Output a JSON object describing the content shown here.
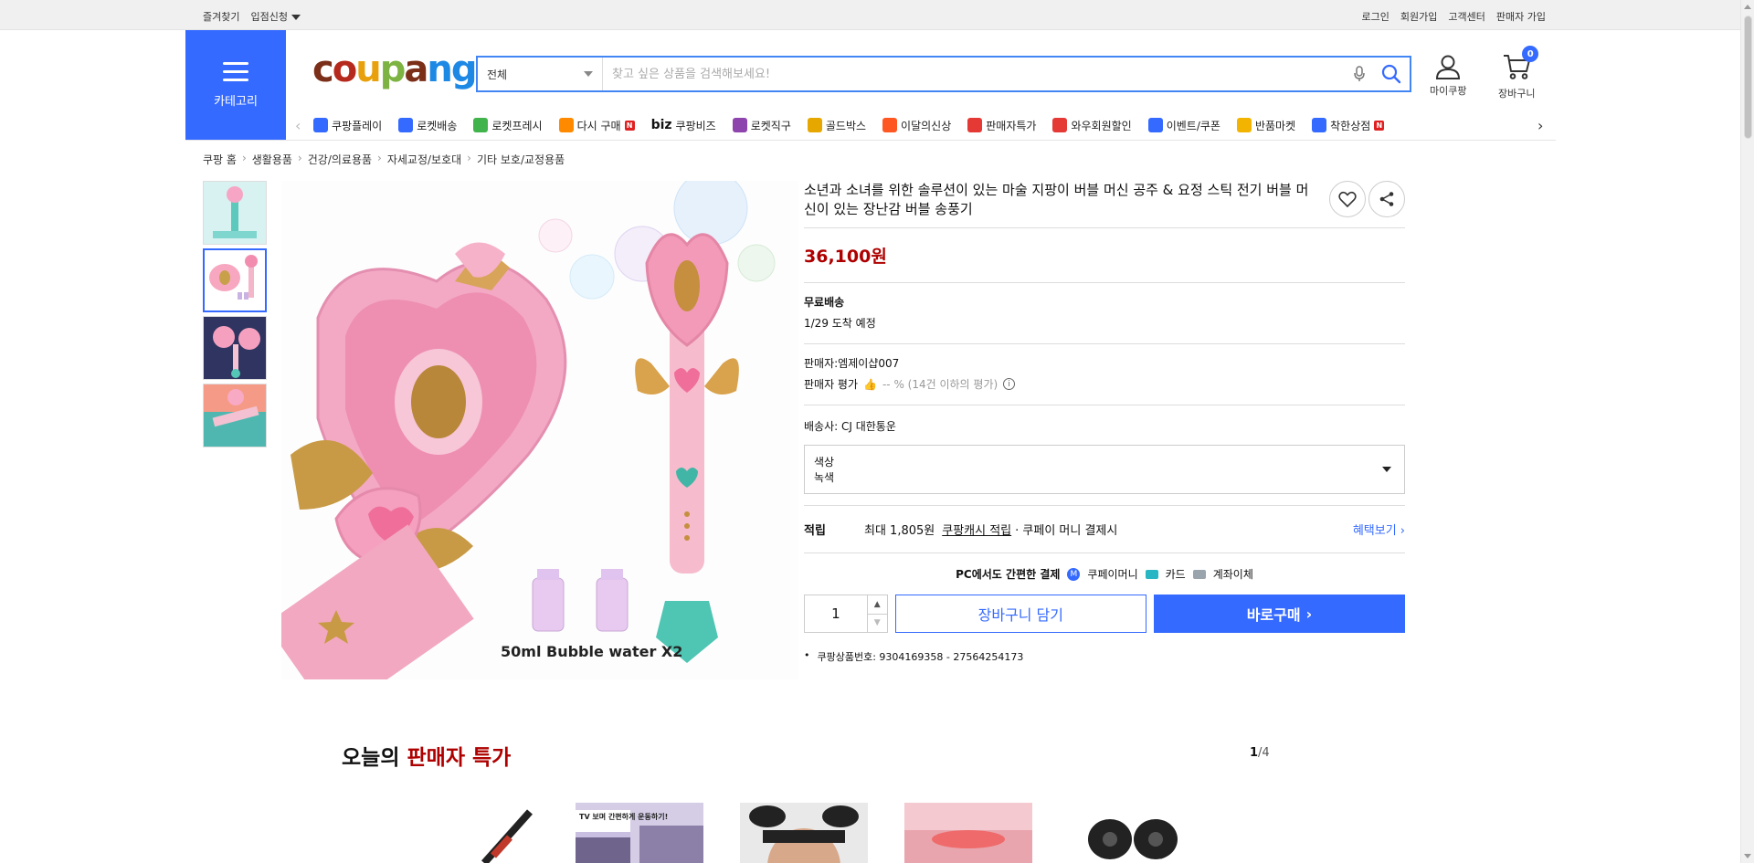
{
  "topbar": {
    "left": [
      "즐겨찾기",
      "입점신청"
    ],
    "right": [
      "로그인",
      "회원가입",
      "고객센터",
      "판매자 가입"
    ]
  },
  "header": {
    "category_label": "카테고리",
    "logo_text": "coupang",
    "search": {
      "category_selected": "전체",
      "placeholder": "찾고 싶은 상품을 검색해보세요!"
    },
    "mycoupang_label": "마이쿠팡",
    "cart_label": "장바구니",
    "cart_count": "0"
  },
  "menu": {
    "items": [
      {
        "label": "쿠팡플레이",
        "icon": "play-icon",
        "color": "#346aff"
      },
      {
        "label": "로켓배송",
        "icon": "rocket-icon",
        "color": "#346aff"
      },
      {
        "label": "로켓프레시",
        "icon": "rocket-fresh-icon",
        "color": "#41b34c"
      },
      {
        "label": "다시 구매",
        "icon": "rebuy-icon",
        "color": "#ff8a00",
        "badge": "N"
      },
      {
        "label": "쿠팡비즈",
        "icon": "biz-icon",
        "color": "#111",
        "prefix": "biz"
      },
      {
        "label": "로켓직구",
        "icon": "rocket-global-icon",
        "color": "#8e44ad"
      },
      {
        "label": "골드박스",
        "icon": "gold-box-icon",
        "color": "#e6a800"
      },
      {
        "label": "이달의신상",
        "icon": "new-icon",
        "color": "#ff5722"
      },
      {
        "label": "판매자특가",
        "icon": "percent-icon",
        "color": "#e53935"
      },
      {
        "label": "와우회원할인",
        "icon": "wow-icon",
        "color": "#e53935"
      },
      {
        "label": "이벤트/쿠폰",
        "icon": "event-icon",
        "color": "#346aff"
      },
      {
        "label": "반품마켓",
        "icon": "return-market-icon",
        "color": "#f2b400"
      },
      {
        "label": "착한상점",
        "icon": "good-shop-icon",
        "color": "#346aff",
        "badge": "N"
      }
    ]
  },
  "breadcrumb": [
    "쿠팡 홈",
    "생활용품",
    "건강/의료용품",
    "자세교정/보호대",
    "기타 보호/교정용품"
  ],
  "product": {
    "title": "소년과 소녀를 위한 솔루션이 있는 마술 지팡이 버블 머신 공주 & 요정 스틱 전기 버블 머신이 있는 장난감 버블 송풍기",
    "price": "36,100원",
    "image_caption": "50ml Bubble water X2",
    "shipping_label": "무료배송",
    "arrival": "1/29 도착 예정",
    "seller": "판매자:엠제이샵007",
    "seller_rating_label": "판매자 평가",
    "seller_rating_value": "-- % (14건 이하의 평가)",
    "carrier": "배송사:  CJ 대한통운",
    "option_label": "색상",
    "option_value": "녹색",
    "reward_label": "적립",
    "reward_text_a": "최대 1,805원",
    "reward_link": "쿠팡캐시 적립",
    "reward_text_b": "· 쿠페이 머니 결제시",
    "benefit_link": "혜택보기",
    "pay_intro": "PC에서도 간편한 결제",
    "pay_methods": [
      "쿠페이머니",
      "카드",
      "계좌이체"
    ],
    "quantity": "1",
    "add_cart": "장바구니 담기",
    "buy_now": "바로구매",
    "product_no": "쿠팡상품번호: 9304169358 - 27564254173"
  },
  "deals": {
    "title_a": "오늘의",
    "title_b": "판매자 특가",
    "page_current": "1",
    "page_total": "/4",
    "tile2_text": "TV 보며 간편하게 운동하기!"
  },
  "colors": {
    "accent": "#346aff",
    "price_red": "#ae0000"
  }
}
